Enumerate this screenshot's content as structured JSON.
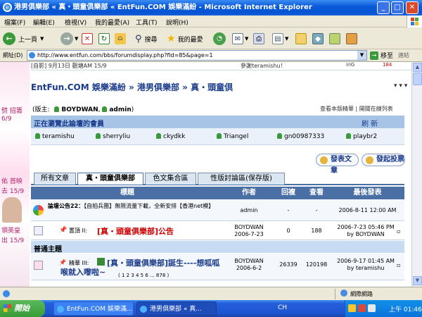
{
  "window": {
    "title": "港男俱樂部 « 真・頭童俱樂部 « EntFun.COM 娛樂滿紛 - Microsoft Internet Explorer",
    "min": "_",
    "max": "□",
    "close": "✕"
  },
  "menu": [
    "檔案(F)",
    "編輯(E)",
    "檢視(V)",
    "我的最愛(A)",
    "工具(T)",
    "說明(H)"
  ],
  "toolbar": {
    "back": "上一頁",
    "search": "搜尋",
    "favorites": "我的最愛"
  },
  "address": {
    "label": "網址(D)",
    "url": "http://www.entfun.com/bbs/forumdisplay.php?fid=85&page=1",
    "go": "移至",
    "links": "連結"
  },
  "top_remnant": {
    "left": "[自影] 9月13日 觀塘AM 15/9",
    "right": "參謝teramishu！",
    "tiny": "iriG",
    "num": "184"
  },
  "left_strip": [
    "劈 招籌",
    "6/9",
    "佑 首映",
    "去 15/9",
    "領英皇",
    "出 15/9"
  ],
  "breadcrumb": "EntFun.COM 娛樂滿紛 » 港男俱樂部 » 真・頭童倶",
  "dots": "▾ ▾ ▾",
  "moderators": {
    "label": "(版主:",
    "users": [
      "BOYDWAN",
      "admin"
    ],
    "close": ")",
    "links": "查看本版精華 | 開關在線列表"
  },
  "online": {
    "title": "正在瀏覽此論壇的會員",
    "refresh": "刷 新",
    "members": [
      "teramishu",
      "sherryliu",
      "ckydkk",
      "Triangel",
      "gn00987333",
      "playbr2"
    ]
  },
  "buttons": {
    "new_topic": "發表文章",
    "new_poll": "發起投票"
  },
  "tabs": [
    "所有文章",
    "真・頭童俱樂部",
    "色文集合區",
    "性版討論區(保存版)"
  ],
  "table": {
    "headers": [
      "標題",
      "作者",
      "回複",
      "查看",
      "最後發表"
    ],
    "announcement": {
      "prefix": "論壇公告22：",
      "title": "【自拍兵團】無限流量下載，全新安排【香港net模】",
      "author": "admin",
      "replies": "-",
      "views": "-",
      "last": "2006-8-11 12:00 AM"
    },
    "pinned": {
      "prefix": "置頂 II:",
      "title": "[真・頭童俱樂部]公告",
      "author": "BOYDWAN",
      "date": "2006-7-23",
      "replies": "0",
      "views": "188",
      "last": "2006-7-23 05:46 PM",
      "last_by": "by BOYDWAN"
    },
    "section": "普通主題",
    "normal": {
      "prefix": "精華 III:",
      "title": "[真・頭童俱樂部]誕生----想呱呱",
      "title2": "喉就入嚟啦~",
      "pages": "( 1 2 3 4 5 6 ... 878 )",
      "author": "BOYDWAN",
      "date": "2006-6-2",
      "replies": "26339",
      "views": "120198",
      "last": "2006-9-17 01:45 AM",
      "last_by": "by teramishu"
    }
  },
  "status": {
    "zone": "網際網路"
  },
  "taskbar": {
    "start": "開始",
    "tasks": [
      "EntFun.COM 娛樂滿...",
      "港男俱樂部 « 真..."
    ],
    "lang": "CH",
    "time": "上午 01:46"
  },
  "colors": {
    "header_bg": "#4a6fa5",
    "bar_bg": "#a7c4e7",
    "title_red": "#cc0000",
    "link_blue": "#1a3a8a"
  }
}
